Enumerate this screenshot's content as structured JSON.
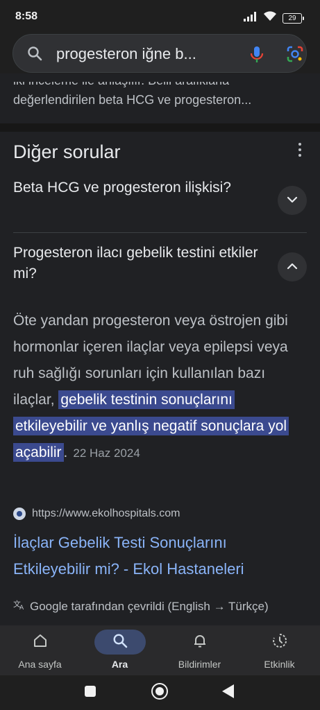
{
  "status_bar": {
    "time": "8:58",
    "battery": "29"
  },
  "search": {
    "query": "progesteron iğne b..."
  },
  "previous_snippet": {
    "line1": "iki inceleme ile anlaşılır. Belli aralıklarla",
    "line2": "değerlendirilen beta HCG ve progesteron..."
  },
  "other_questions": {
    "title": "Diğer sorular",
    "questions": [
      {
        "text": "Beta HCG ve progesteron ilişkisi?",
        "expanded": false
      },
      {
        "text": "Progesteron ilacı gebelik testini etkiler mi?",
        "expanded": true
      }
    ],
    "answer": {
      "text_plain": "Öte yandan progesteron veya östrojen gibi hormonlar içeren ilaçlar veya epilepsi veya ruh sağlığı sorunları için kullanılan bazı ilaçlar, ",
      "text_highlight": "gebelik testinin sonuçlarını etkileyebilir ve yanlış negatif sonuçlara yol açabilir",
      "text_end": ".",
      "date": "22 Haz 2024"
    },
    "source": {
      "url": "https://www.ekolhospitals.com",
      "link_title": "İlaçlar Gebelik Testi Sonuçlarını Etkileyebilir mi? - Ekol Hastaneleri"
    },
    "translation_note": "Google tarafından çevrildi (English → Türkçe)"
  },
  "bottom_nav": {
    "items": [
      {
        "label": "Ana sayfa",
        "icon": "home-icon",
        "active": false
      },
      {
        "label": "Ara",
        "icon": "search-icon",
        "active": true
      },
      {
        "label": "Bildirimler",
        "icon": "bell-icon",
        "active": false
      },
      {
        "label": "Etkinlik",
        "icon": "activity-icon",
        "active": false
      }
    ]
  },
  "colors": {
    "background": "#202124",
    "link": "#8ab4f8",
    "highlight": "#3b4a8f",
    "active_nav_pill": "#3c4a6e"
  }
}
